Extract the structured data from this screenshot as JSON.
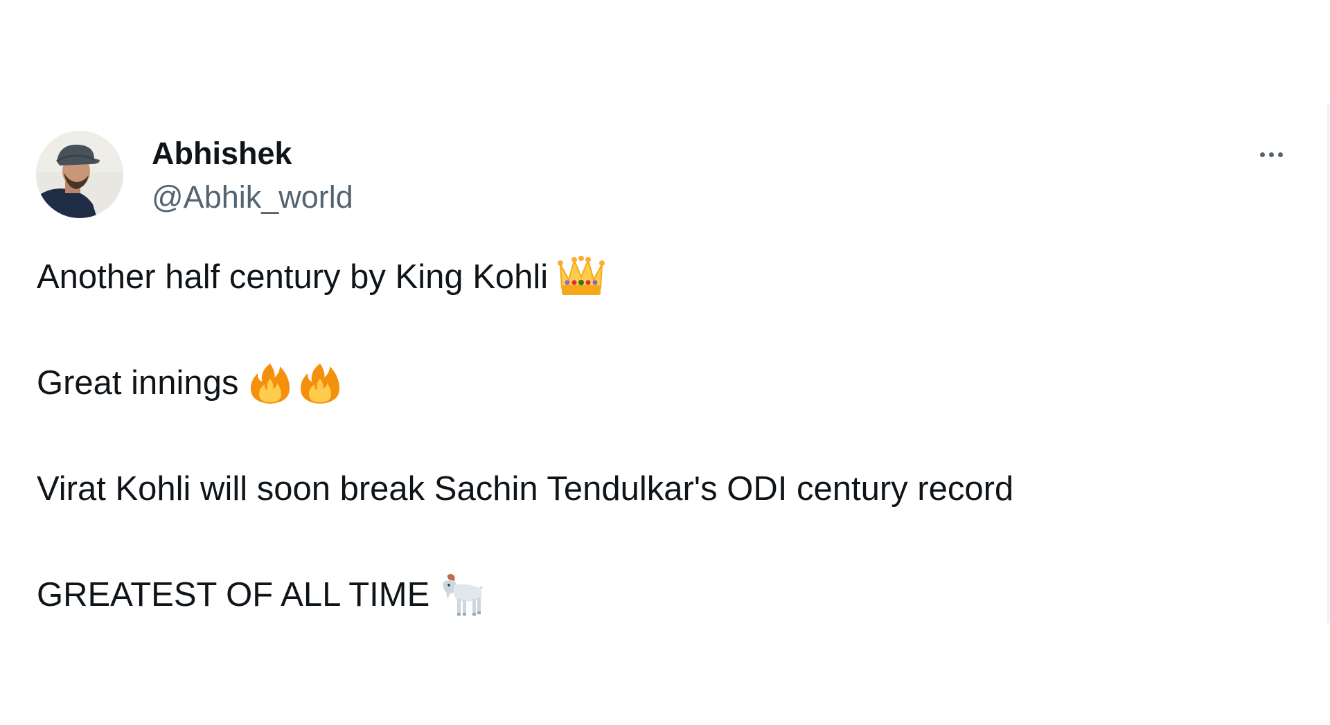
{
  "tweet": {
    "author": {
      "display_name": "Abhishek",
      "handle": "@Abhik_world",
      "avatar_icon": "user-avatar-photo"
    },
    "more_icon": "more-horizontal-icon",
    "lines": [
      {
        "text": "Another half century by King Kohli",
        "emojis": [
          "crown-emoji"
        ]
      },
      {
        "text": "Great innings",
        "emojis": [
          "fire-emoji",
          "fire-emoji"
        ]
      },
      {
        "text": "Virat Kohli will soon break Sachin Tendulkar's ODI century record",
        "emojis": []
      },
      {
        "text": "GREATEST OF ALL TIME",
        "emojis": [
          "goat-emoji"
        ]
      }
    ]
  },
  "colors": {
    "text_primary": "#0f1419",
    "text_secondary": "#536471",
    "border": "#eff3f4",
    "crown_gold": "#ffcc4d",
    "fire_orange": "#f4900c",
    "fire_yellow": "#ffcc4d"
  }
}
